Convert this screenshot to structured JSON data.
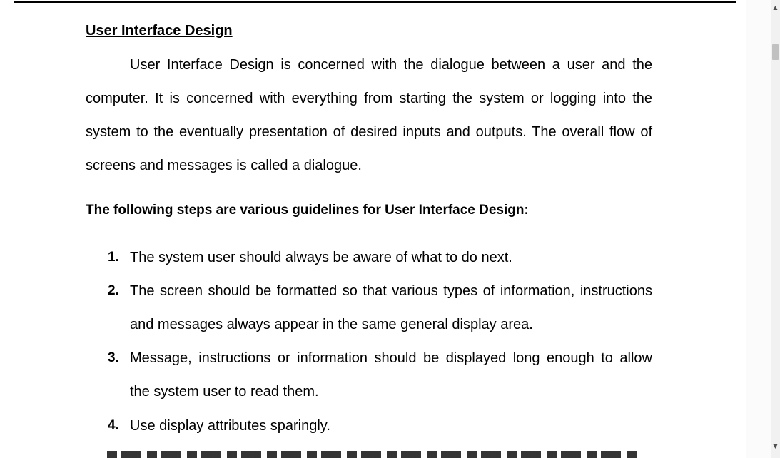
{
  "document": {
    "heading": "User Interface Design",
    "paragraph_lines": [
      "User Interface Design is concerned with the dialogue between a user and the",
      "computer. It is concerned with everything from starting the system or logging into the",
      "system to the eventually presentation of desired inputs and outputs. The overall flow of",
      "screens and messages is called a dialogue."
    ],
    "subheading": "The following steps are various guidelines for User Interface Design:",
    "list_items": [
      {
        "number": "1.",
        "lines": [
          "The system user should always be aware of what to do next."
        ]
      },
      {
        "number": "2.",
        "lines": [
          "The screen should be formatted so that various types of information, instructions",
          "and messages always appear in the same general display area."
        ]
      },
      {
        "number": "3.",
        "lines": [
          "Message, instructions or information should be displayed long enough to allow",
          "the system user to read them."
        ]
      },
      {
        "number": "4.",
        "lines": [
          "Use display attributes sparingly."
        ]
      }
    ]
  },
  "scrollbar": {
    "up_arrow_icon": "triangle-up",
    "down_arrow_icon": "triangle-down",
    "up_arrow_glyph": "▲",
    "down_arrow_glyph": "▼"
  }
}
